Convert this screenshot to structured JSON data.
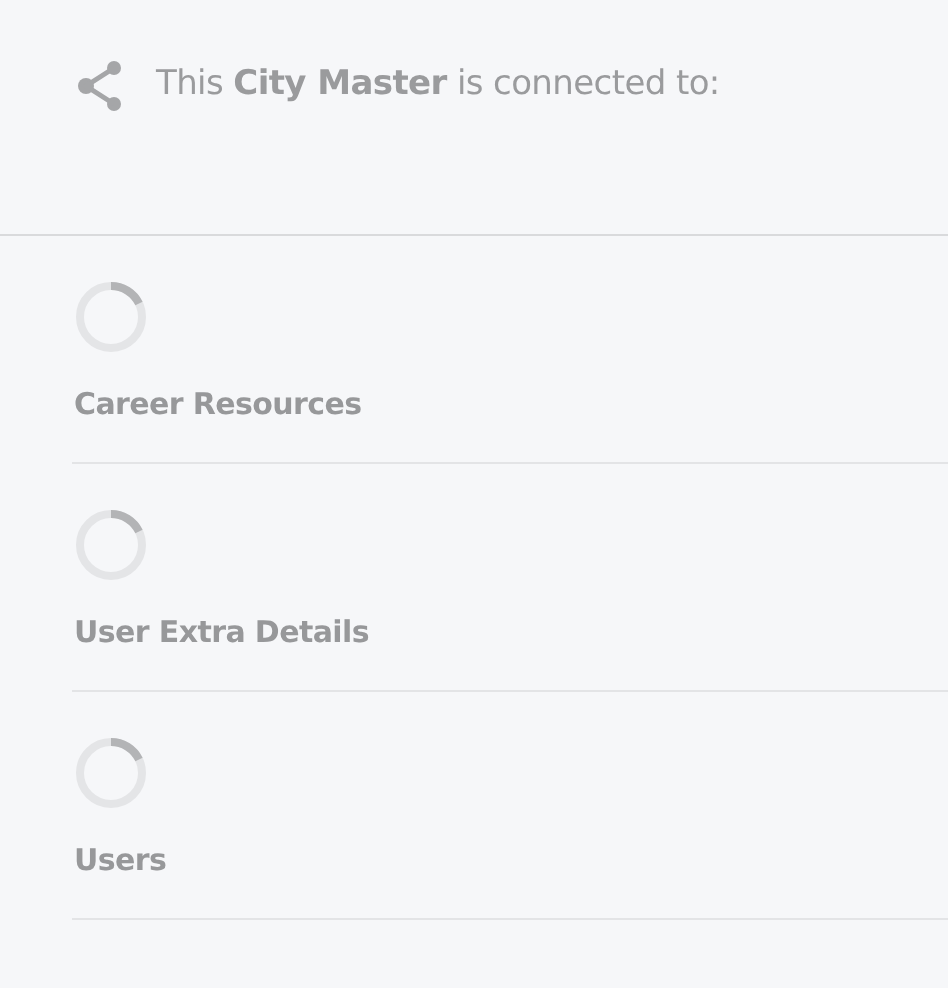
{
  "header": {
    "title": "This **City Master** is connected to:"
  },
  "connections": [
    {
      "label": "Career Resources"
    },
    {
      "label": "User Extra Details"
    },
    {
      "label": "Users"
    }
  ]
}
